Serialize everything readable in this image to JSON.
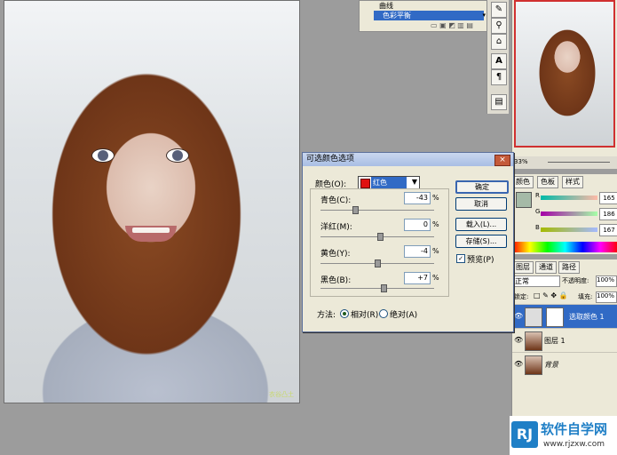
{
  "layers_top": {
    "rows": [
      "曲线",
      "色彩平衡"
    ]
  },
  "navigator": {
    "zoom": "33%"
  },
  "color_panel": {
    "tabs": [
      "颜色",
      "色板",
      "样式"
    ],
    "sliders": [
      {
        "label": "R",
        "value": "165"
      },
      {
        "label": "G",
        "value": "186"
      },
      {
        "label": "B",
        "value": "167"
      }
    ]
  },
  "layers_panel": {
    "tabs": [
      "图层",
      "通道",
      "路径"
    ],
    "blend_mode": "正常",
    "opacity_label": "不透明度:",
    "opacity_value": "100%",
    "lock_label": "锁定:",
    "fill_label": "填充:",
    "fill_value": "100%",
    "layers": [
      {
        "name": "选取颜色 1",
        "selected": true
      },
      {
        "name": "图层 1",
        "selected": false
      },
      {
        "name": "背景",
        "selected": false
      }
    ]
  },
  "dialog": {
    "title": "可选颜色选项",
    "close": "×",
    "color_label": "颜色(O):",
    "color_value": "红色",
    "sliders": [
      {
        "label": "青色(C):",
        "value": "-43",
        "unit": "%"
      },
      {
        "label": "洋红(M):",
        "value": "0",
        "unit": "%"
      },
      {
        "label": "黄色(Y):",
        "value": "-4",
        "unit": "%"
      },
      {
        "label": "黑色(B):",
        "value": "+7",
        "unit": "%"
      }
    ],
    "buttons": {
      "ok": "确定",
      "cancel": "取消",
      "load": "载入(L)...",
      "save": "存储(S)..."
    },
    "preview_label": "预览(P)",
    "preview_checked": true,
    "method_label": "方法:",
    "method_relative": "相对(R)",
    "method_absolute": "绝对(A)",
    "method_selected": "relative"
  },
  "canvas": {
    "corner_mark": "衣谷凸土"
  },
  "brand": {
    "logo": "RJ",
    "title": "软件自学网",
    "url": "www.rjzxw.com"
  }
}
